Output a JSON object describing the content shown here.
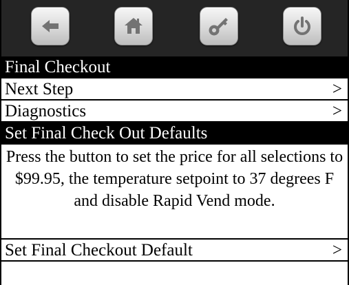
{
  "toolbar": {
    "buttons": [
      {
        "icon": "back-arrow-icon"
      },
      {
        "icon": "home-icon"
      },
      {
        "icon": "key-icon"
      },
      {
        "icon": "power-icon"
      }
    ],
    "background": "#252525"
  },
  "section_final_checkout": {
    "title": "Final Checkout",
    "items": [
      {
        "label": "Next Step",
        "chevron": ">"
      },
      {
        "label": "Diagnostics",
        "chevron": ">"
      }
    ]
  },
  "section_defaults": {
    "title": "Set Final Check Out Defaults",
    "description": "Press the button to set the price for all selections to $99.95, the temperature setpoint to 37 degrees F and disable Rapid Vend mode.",
    "action": {
      "label": "Set Final Checkout Default",
      "chevron": ">"
    }
  },
  "colors": {
    "header_bg": "#000000",
    "header_text": "#ffffff",
    "icon": "#737373"
  }
}
